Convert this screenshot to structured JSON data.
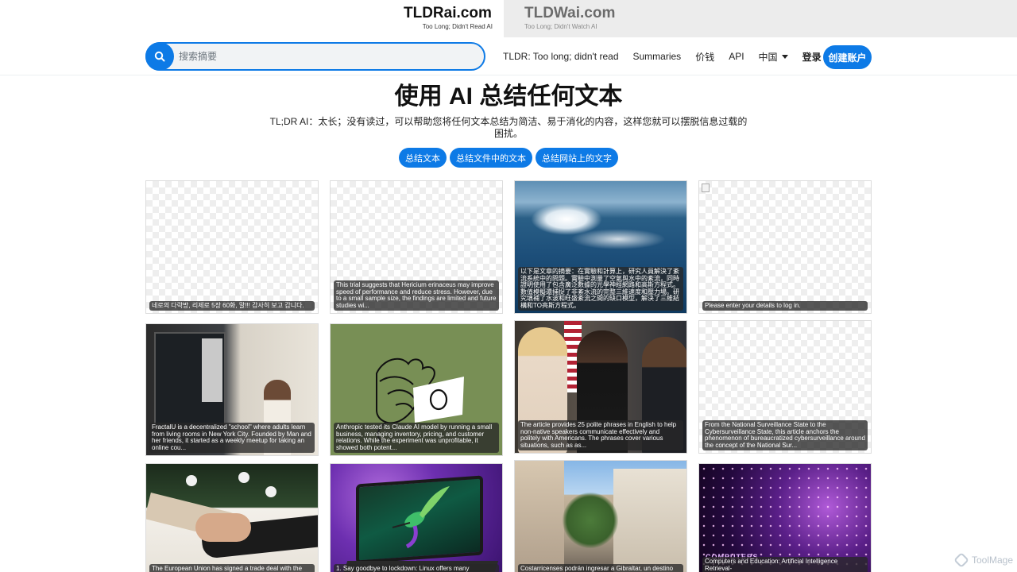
{
  "brand": {
    "active": {
      "title": "TLDRai.com",
      "subtitle": "Too Long; Didn't Read AI"
    },
    "inactive": {
      "title": "TLDWai.com",
      "subtitle": "Too Long; Didn't Watch AI"
    }
  },
  "search": {
    "placeholder": "搜索摘要",
    "value": "",
    "icon": "search-icon"
  },
  "nav": {
    "tldr": "TLDR: Too long; didn't read",
    "summaries": "Summaries",
    "pricing": "价钱",
    "api": "API",
    "language": "中国",
    "login": "登录",
    "signup": "创建账户"
  },
  "hero": {
    "title": "使用 AI 总结任何文本",
    "description": "TL;DR AI：太长；没有读过，可以帮助您将任何文本总结为简洁、易于消化的内容，这样您就可以摆脱信息过载的困扰。",
    "buttons": [
      "总结文本",
      "总结文件中的文本",
      "总结网站上的文字"
    ]
  },
  "cards": [
    {
      "caption": "네로의 다락방, 리제로 5장 60화, 말!!! 감사히 보고 갑니다."
    },
    {
      "caption": "This trial suggests that Hericium erinaceus may improve speed of performance and reduce stress. However, due to a small sample size, the findings are limited and future studies wi..."
    },
    {
      "caption": "以下是文章的摘要：在實驗和計算上，研究人員解決了紊流系統中的問題。實驗中測量了空氣與水中的紊流，同時證明使用了包含廣泛數據的光學神經網路和高斯方程式。數值模擬還捕捉了非紊水流的完整三維速度和壓力場。研究填補了水波和旺盛紊流之間的缺口模型，解決了三維結構和TO亮斯方程式。"
    },
    {
      "caption": "Please enter your details to log in."
    },
    {
      "caption": "FractalU is a decentralized \"school\" where adults learn from living rooms in New York City. Founded by Man and her friends, it started as a weekly meetup for taking an online cou..."
    },
    {
      "caption": "Anthropic tested its Claude AI model by running a small business, managing inventory, pricing, and customer relations. While the experiment was unprofitable, it showed both potent..."
    },
    {
      "caption": "The article provides 25 polite phrases in English to help non-native speakers communicate effectively and politely with Americans. The phrases cover various situations, such as as..."
    },
    {
      "caption": "From the National Surveillance State to the Cybersurveillance State, this article anchors the phenomenon of bureaucratized cybersurveillance around the concept of the National Sur..."
    },
    {
      "caption": "The European Union has signed a trade deal with the"
    },
    {
      "caption": "1. Say goodbye to lockdown: Linux offers many"
    },
    {
      "caption": "Costarricenses podrán ingresar a Gibraltar, un destino"
    },
    {
      "caption": "Computers and Education: Artificial Intelligence Retrieval-"
    }
  ],
  "neon_overlay_text": "COMPUTERS",
  "watermark": "ToolMage",
  "colors": {
    "accent": "#0d7ae6",
    "inactive_tab": "#ececec"
  }
}
